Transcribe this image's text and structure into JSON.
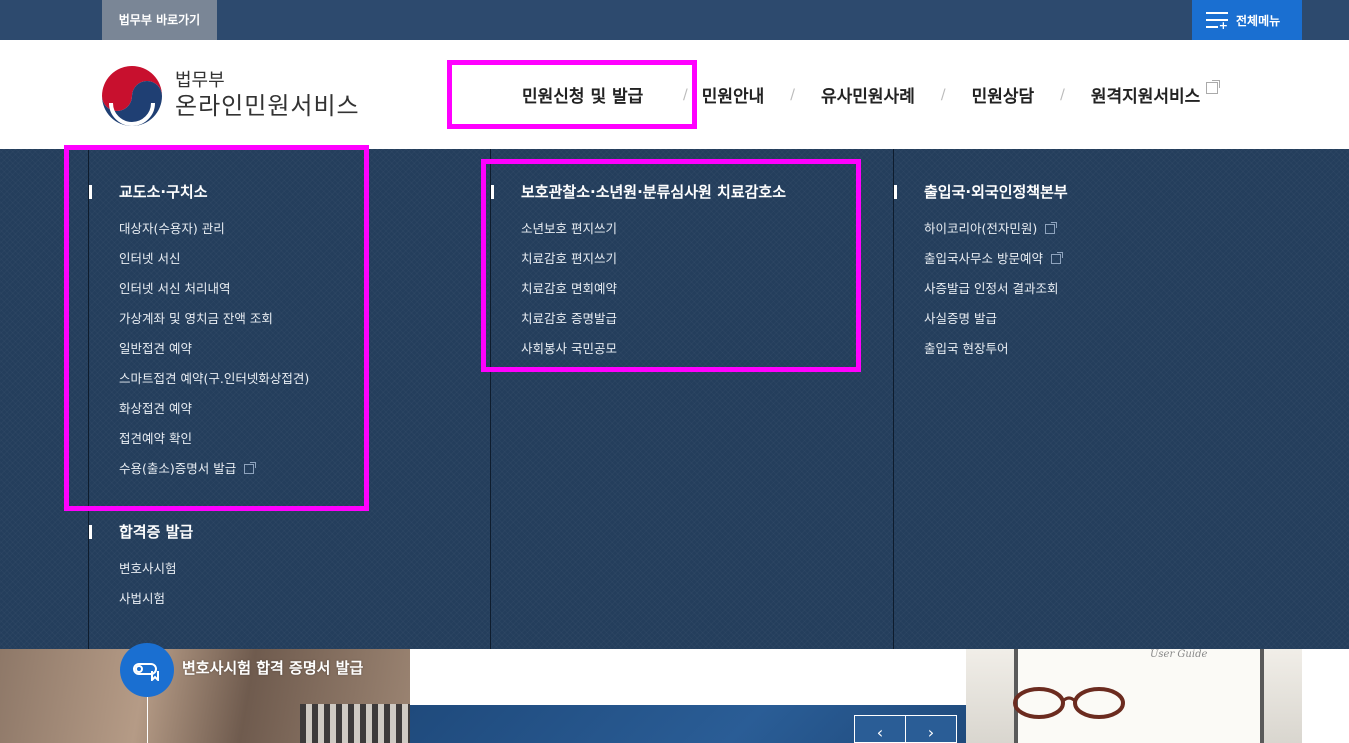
{
  "topbar": {
    "ministry_link": "법무부 바로가기",
    "allmenu_label": "전체메뉴"
  },
  "logo": {
    "sub": "법무부",
    "main": "온라인민원서비스"
  },
  "gnb": [
    {
      "label": "민원신청 및 발급"
    },
    {
      "label": "민원안내"
    },
    {
      "label": "유사민원사례"
    },
    {
      "label": "민원상담"
    },
    {
      "label": "원격지원서비스"
    }
  ],
  "gnb_sep": "/",
  "menu": {
    "col1": {
      "group1": {
        "title": "교도소·구치소",
        "items": [
          "대상자(수용자) 관리",
          "인터넷 서신",
          "인터넷 서신 처리내역",
          "가상계좌 및 영치금 잔액 조회",
          "일반접견 예약",
          "스마트접견 예약(구.인터넷화상접견)",
          "화상접견 예약",
          "접견예약 확인",
          "수용(출소)증명서 발급"
        ]
      },
      "group2": {
        "title": "합격증 발급",
        "items": [
          "변호사시험",
          "사법시험"
        ]
      }
    },
    "col2": {
      "group1": {
        "title": "보호관찰소·소년원·분류심사원 치료감호소",
        "items": [
          "소년보호 편지쓰기",
          "치료감호 편지쓰기",
          "치료감호 면회예약",
          "치료감호 증명발급",
          "사회봉사 국민공모"
        ]
      }
    },
    "col3": {
      "group1": {
        "title": "출입국·외국인정책본부",
        "items": [
          "하이코리아(전자민원)",
          "출입국사무소 방문예약",
          "사증발급 인정서 결과조회",
          "사실증명 발급",
          "출입국 현장투어"
        ]
      }
    }
  },
  "banner": {
    "cert_title": "변호사시험 합격 증명서 발급",
    "user_guide": "User Guide",
    "prev": "‹",
    "next": "›"
  },
  "colors": {
    "topbar": "#2d4a6e",
    "accent_blue": "#1a6fd1",
    "mega_bg": "#243e5c",
    "highlight": "#ff00ff"
  }
}
